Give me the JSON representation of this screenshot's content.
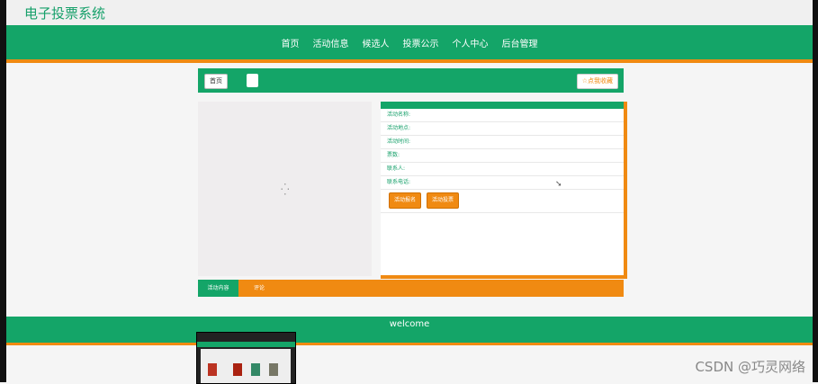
{
  "site": {
    "title": "电子投票系统"
  },
  "nav": {
    "items": [
      "首页",
      "活动信息",
      "候选人",
      "投票公示",
      "个人中心",
      "后台管理"
    ]
  },
  "breadcrumb": {
    "home": "首页",
    "favorite": "☆点我收藏"
  },
  "details": {
    "rows": [
      "活动名称:",
      "活动地点:",
      "活动时间:",
      "票数:",
      "联系人:",
      "联系电话:"
    ],
    "register_label": "活动报名",
    "vote_label": "活动投票"
  },
  "tabs": {
    "content": "活动内容",
    "comment": "评论"
  },
  "footer": {
    "text": "welcome"
  },
  "watermark": "CSDN @巧灵网络",
  "colors": {
    "primary": "#14a568",
    "accent": "#f08a12"
  }
}
